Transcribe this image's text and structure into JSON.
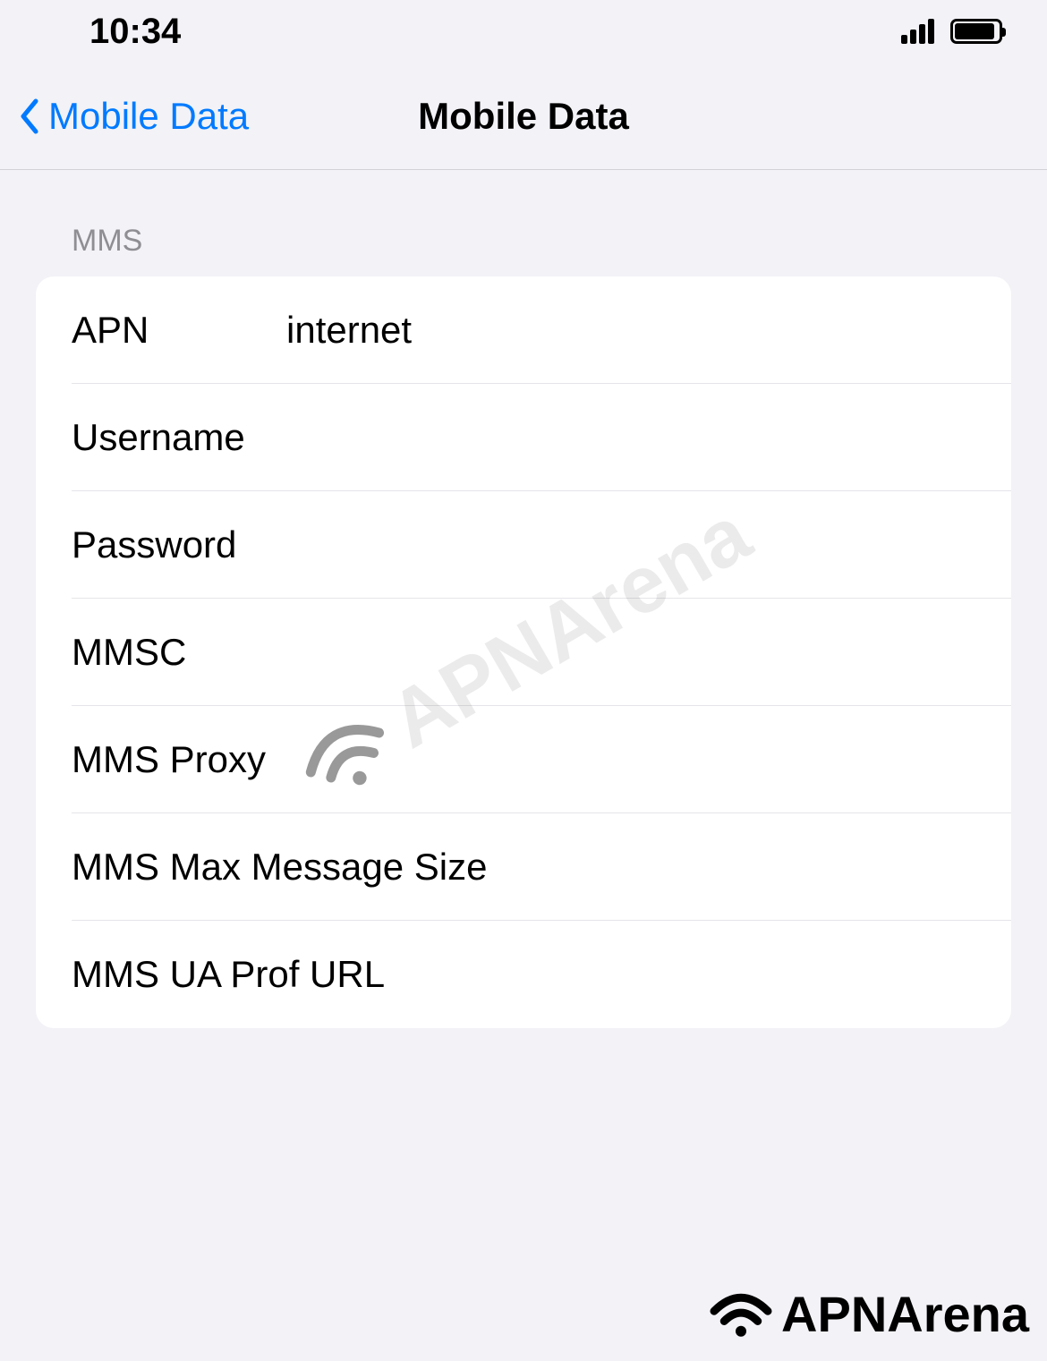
{
  "status": {
    "time": "10:34"
  },
  "nav": {
    "back_label": "Mobile Data",
    "title": "Mobile Data"
  },
  "section": {
    "header": "MMS",
    "rows": [
      {
        "label": "APN",
        "value": "internet"
      },
      {
        "label": "Username",
        "value": ""
      },
      {
        "label": "Password",
        "value": ""
      },
      {
        "label": "MMSC",
        "value": ""
      },
      {
        "label": "MMS Proxy",
        "value": ""
      },
      {
        "label": "MMS Max Message Size",
        "value": ""
      },
      {
        "label": "MMS UA Prof URL",
        "value": ""
      }
    ]
  },
  "watermark": {
    "text": "APNArena"
  },
  "footer": {
    "text": "APNArena"
  }
}
